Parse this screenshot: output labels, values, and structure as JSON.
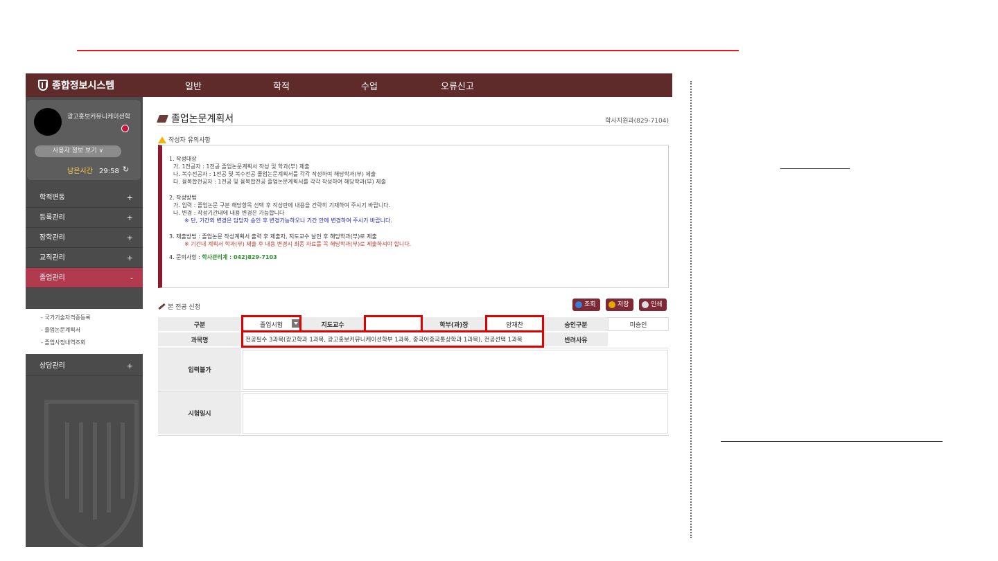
{
  "app": {
    "title": "종합정보시스템",
    "menu": [
      "일반",
      "학적",
      "수업",
      "오류신고"
    ]
  },
  "user": {
    "department": "광고홍보커뮤니케이션학",
    "info_button": "사용자 정보 보기",
    "timer_label": "남은시간",
    "timer_value": "29:58"
  },
  "sidebar": {
    "items": [
      {
        "label": "학적변동",
        "toggle": "+"
      },
      {
        "label": "등록관리",
        "toggle": "+"
      },
      {
        "label": "장학관리",
        "toggle": "+"
      },
      {
        "label": "교직관리",
        "toggle": "+"
      },
      {
        "label": "졸업관리",
        "toggle": "-"
      },
      {
        "label": "상담관리",
        "toggle": "+"
      }
    ],
    "sub_items": [
      "- 국가기술자격증등록",
      "- 졸업논문계획서",
      "- 졸업사정내역조회"
    ]
  },
  "page": {
    "title": "졸업논문계획서",
    "contact": "학사지원과(829-7104)",
    "notice_label": "작성자 유의사항",
    "notice": {
      "s1_title": "1. 작성대상",
      "s1_a": "가. 1전공자 : 1전공 졸업논문계획서 작성 및 학과(부) 제출",
      "s1_b": "나. 복수전공자 : 1전공 및 복수전공 졸업논문계획서를 각각 작성하여 해당학과(부) 제출",
      "s1_c": "다. 융복합전공자 : 1전공 및 융복합전공 졸업논문계획서를 각각 작성하여 해당학과(부) 제출",
      "s2_title": "2. 작성방법",
      "s2_a": "가. 입력 : 졸업논문 구분 해당항목 선택 후 작성란에 내용을 간략히 기재하여 주시기 바랍니다.",
      "s2_b": "나. 변경 : 작성기간내에 내용 변경은 가능합니다",
      "s2_note": "※ 단, 기간외 변경은 담당자 승인 후 변경가능하오니 기간 안에 변경하여 주시기 바랍니다.",
      "s3_title": "3. 제출방법 : 졸업논문 작성계획서 출력 후 제출자, 지도교수 날인 후 해당학과(부)로 제출",
      "s3_note": "※ 기간내 계획서 학과(부) 제출 후 내용 변경시 최종 자료를 꼭 해당학과(부)로 제출하셔야 합니다.",
      "s4_label": "4. 문의사항 : ",
      "s4_value": "학사관리계 : 042)829-7103"
    },
    "section_label": "본 전공 신청",
    "buttons": {
      "search": "조회",
      "save": "저장",
      "print": "인쇄"
    },
    "form": {
      "type_label": "구분",
      "type_value": "졸업시험",
      "advisor_label": "지도교수",
      "advisor_value": "",
      "chair_label": "학부(과)장",
      "chair_value": "양재찬",
      "approval_label": "승인구분",
      "approval_value": "미승인",
      "course_label": "과목명",
      "course_value": "전공필수 3과목(광고학과 1과목, 광고홍보커뮤니케이션학부 1과목, 중국어중국통상학과 1과목), 전공선택 1과목",
      "reject_label": "반려사유",
      "input_label": "입력불가",
      "exam_date_label": "시험일시"
    }
  },
  "colors": {
    "topbar": "#5e2a2a",
    "sidebar": "#4b4b4b",
    "accent": "#8b1a30",
    "highlight": "#e00000"
  }
}
